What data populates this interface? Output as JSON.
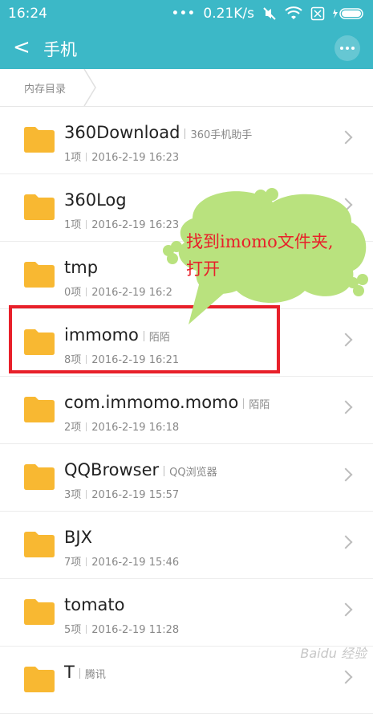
{
  "status": {
    "time": "16:24",
    "speed": "0.21K/s"
  },
  "header": {
    "back_symbol": "<",
    "title": "手机"
  },
  "breadcrumb": {
    "label": "内存目录"
  },
  "annotation": {
    "text": "找到imomo文件夹,打开",
    "color": "#e8202a"
  },
  "colors": {
    "accent": "#3cb8c7",
    "folder": "#f8b832",
    "highlight": "#e8202a"
  },
  "folders": [
    {
      "name": "360Download",
      "tag": "360手机助手",
      "count": "1项",
      "date": "2016-2-19 16:23"
    },
    {
      "name": "360Log",
      "tag": "",
      "count": "1项",
      "date": "2016-2-19 16:23"
    },
    {
      "name": "tmp",
      "tag": "",
      "count": "0项",
      "date": "2016-2-19 16:2"
    },
    {
      "name": "immomo",
      "tag": "陌陌",
      "count": "8项",
      "date": "2016-2-19 16:21"
    },
    {
      "name": "com.immomo.momo",
      "tag": "陌陌",
      "count": "2项",
      "date": "2016-2-19 16:18"
    },
    {
      "name": "QQBrowser",
      "tag": "QQ浏览器",
      "count": "3项",
      "date": "2016-2-19 15:57"
    },
    {
      "name": "BJX",
      "tag": "",
      "count": "7项",
      "date": "2016-2-19 15:46"
    },
    {
      "name": "tomato",
      "tag": "",
      "count": "5项",
      "date": "2016-2-19 11:28"
    },
    {
      "name": "T",
      "tag": "腾讯",
      "count": "",
      "date": ""
    }
  ],
  "watermark": "Baidu 经验"
}
